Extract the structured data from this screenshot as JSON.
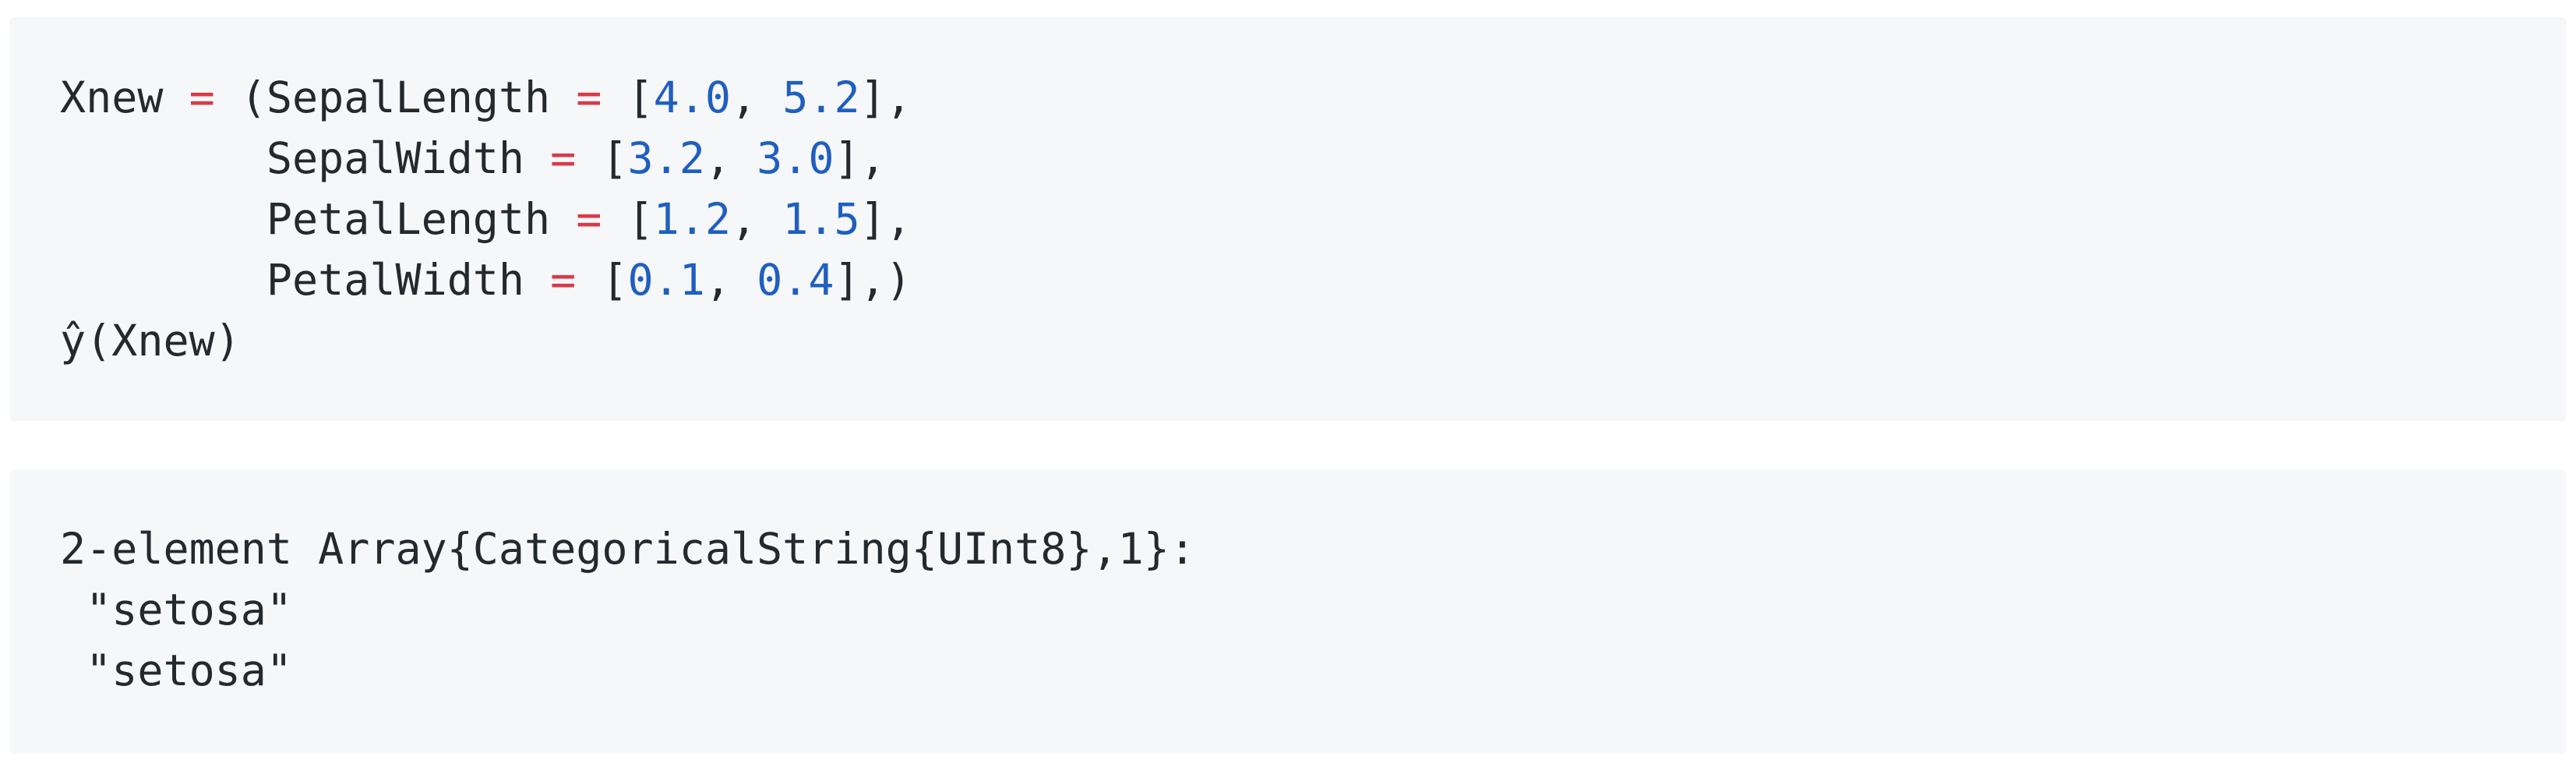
{
  "input_cell": {
    "lines": [
      {
        "indent": "",
        "name": "Xnew",
        "pre": " ",
        "op": "=",
        "post": " (SepalLength ",
        "op2": "=",
        "open": " [",
        "v1": "4.0",
        "sep": ", ",
        "v2": "5.2",
        "close": "],"
      },
      {
        "indent": "        ",
        "name": "SepalWidth",
        "pre": " ",
        "op": "=",
        "open": " [",
        "v1": "3.2",
        "sep": ", ",
        "v2": "3.0",
        "close": "],"
      },
      {
        "indent": "        ",
        "name": "PetalLength",
        "pre": " ",
        "op": "=",
        "open": " [",
        "v1": "1.2",
        "sep": ", ",
        "v2": "1.5",
        "close": "],"
      },
      {
        "indent": "        ",
        "name": "PetalWidth",
        "pre": " ",
        "op": "=",
        "open": " [",
        "v1": "0.1",
        "sep": ", ",
        "v2": "0.4",
        "close": "],)"
      },
      {
        "plain": "ŷ(Xnew)"
      }
    ]
  },
  "output_cell": {
    "lines": [
      "2-element Array{CategoricalString{UInt8},1}:",
      " \"setosa\"",
      " \"setosa\""
    ]
  },
  "colors": {
    "background": "#f6f7f9",
    "text": "#24292e",
    "operator": "#d73a49",
    "number": "#1f5fbf"
  }
}
